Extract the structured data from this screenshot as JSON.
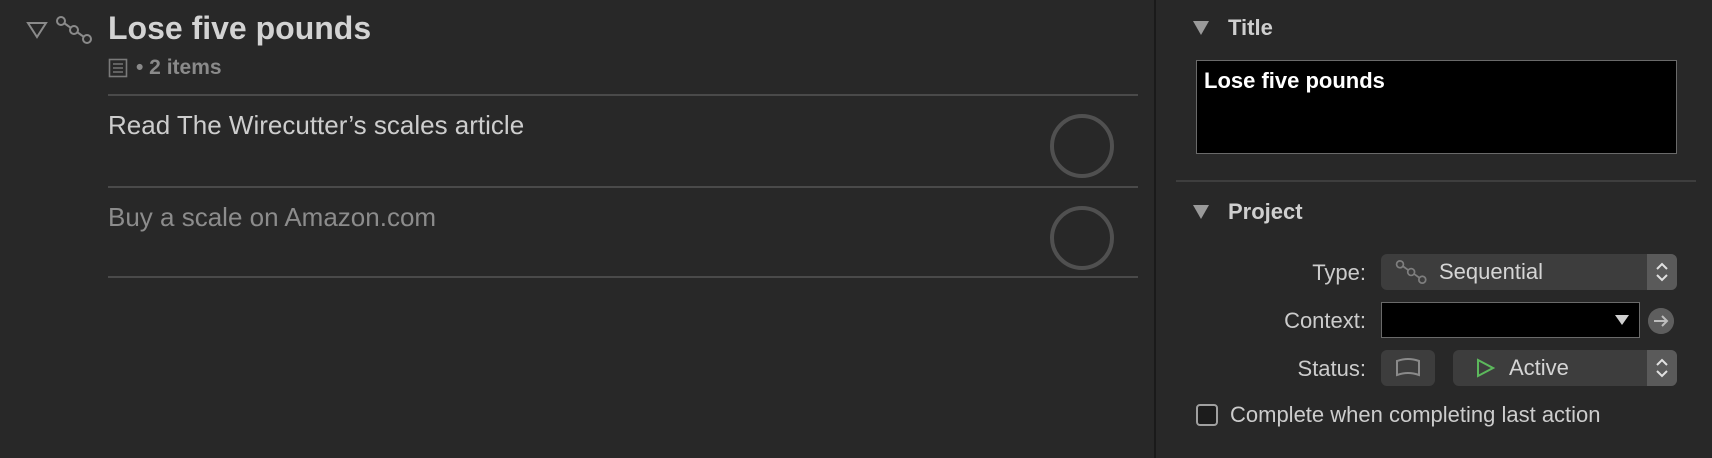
{
  "outline": {
    "project": {
      "title": "Lose five pounds",
      "item_count": "• 2 items",
      "type_icon": "sequential-icon"
    },
    "actions": [
      {
        "title": "Read The Wirecutter’s scales article",
        "state": "available"
      },
      {
        "title": "Buy a scale on Amazon.com",
        "state": "blocked"
      }
    ]
  },
  "inspector": {
    "title_section": {
      "header": "Title",
      "value": "Lose five pounds"
    },
    "project_section": {
      "header": "Project",
      "type": {
        "label": "Type:",
        "value": "Sequential",
        "icon": "sequential-icon"
      },
      "context": {
        "label": "Context:",
        "value": ""
      },
      "status": {
        "label": "Status:",
        "value": "Active",
        "icon": "play-triangle-icon",
        "icon_color": "#5cb85c"
      },
      "complete_checkbox": {
        "label": "Complete when completing last action",
        "checked": false
      }
    }
  },
  "colors": {
    "background": "#282828",
    "accent_green": "#5cb85c"
  }
}
